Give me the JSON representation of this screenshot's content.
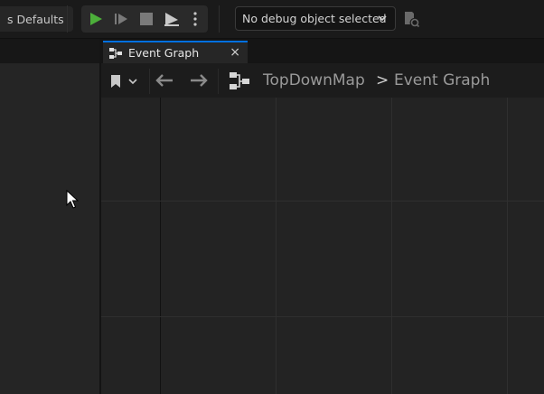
{
  "toolbar": {
    "class_defaults_label": "s Defaults",
    "play_icon": "play-icon",
    "step_icon": "advance-frame-icon",
    "stop_icon": "stop-icon",
    "eject_icon": "eject-icon",
    "more_icon": "vertical-ellipsis-icon",
    "debug_selector": "No debug object selected",
    "colors": {
      "play_green": "#4caf3a",
      "accent_blue": "#0070e0"
    }
  },
  "tabs": [
    {
      "label": "Event Graph",
      "close_glyph": "×"
    }
  ],
  "graph_toolbar": {
    "breadcrumb_root": "TopDownMap",
    "breadcrumb_separator": ">",
    "breadcrumb_current": "Event Graph"
  }
}
